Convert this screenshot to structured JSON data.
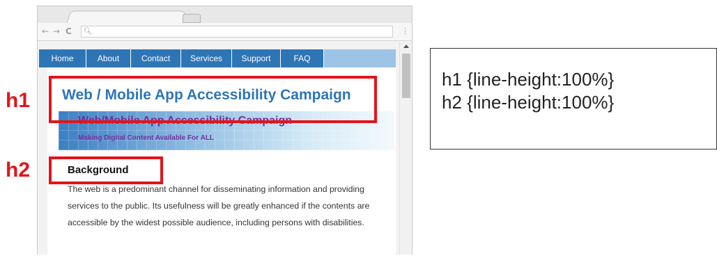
{
  "browser": {
    "nav": {
      "back": "←",
      "forward": "→",
      "reload": "C"
    },
    "address": {
      "value": ""
    },
    "menu": "⋮"
  },
  "site": {
    "nav": [
      {
        "label": "Home",
        "width": 68
      },
      {
        "label": "About",
        "width": 64
      },
      {
        "label": "Contact",
        "width": 72
      },
      {
        "label": "Services",
        "width": 73
      },
      {
        "label": "Support",
        "width": 70
      },
      {
        "label": "FAQ",
        "width": 62
      }
    ],
    "h1": "Web / Mobile App Accessibility Campaign",
    "banner": {
      "title": "Web/Mobile App Accessibility Campaign",
      "subtitle": "Making Digital Content Available For ALL"
    },
    "h2": "Background",
    "body": "The web is a predominant channel for disseminating information and providing services to the public. Its usefulness will be greatly enhanced if the contents are accessible by the widest possible audience, including persons with disabilities."
  },
  "annotations": {
    "h1_label": "h1",
    "h2_label": "h2",
    "css_rules": [
      "h1 {line-height:100%}",
      "h2 {line-height:100%}"
    ],
    "highlight_color": "#e3141b"
  },
  "colors": {
    "nav_bg": "#2e75b6",
    "heading_blue": "#2e75b6",
    "banner_purple": "#7030a0"
  }
}
